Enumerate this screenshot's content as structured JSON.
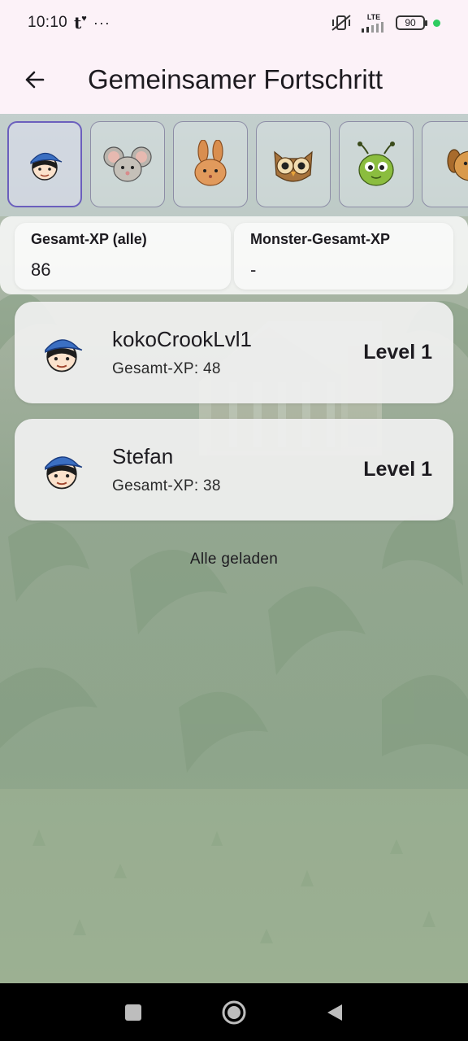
{
  "status_bar": {
    "time": "10:10",
    "tumblr": "t",
    "heart": "♥",
    "dots": "···",
    "network": "LTE",
    "battery": "90",
    "accent": "#2ecc60"
  },
  "app_bar": {
    "title": "Gemeinsamer Fortschritt"
  },
  "avatars": [
    {
      "name": "boy-cap",
      "selected": true
    },
    {
      "name": "mouse",
      "selected": false
    },
    {
      "name": "rabbit",
      "selected": false
    },
    {
      "name": "owl",
      "selected": false
    },
    {
      "name": "bug",
      "selected": false
    },
    {
      "name": "dog",
      "selected": false
    }
  ],
  "summary": {
    "total_xp_label": "Gesamt-XP (alle)",
    "total_xp_value": "86",
    "monster_xp_label": "Monster-Gesamt-XP",
    "monster_xp_value": "-"
  },
  "players": [
    {
      "name": "kokoCrookLvl1",
      "xp": "Gesamt-XP: 48",
      "level": "Level 1"
    },
    {
      "name": "Stefan",
      "xp": "Gesamt-XP: 38",
      "level": "Level 1"
    }
  ],
  "footer_text": "Alle geladen"
}
